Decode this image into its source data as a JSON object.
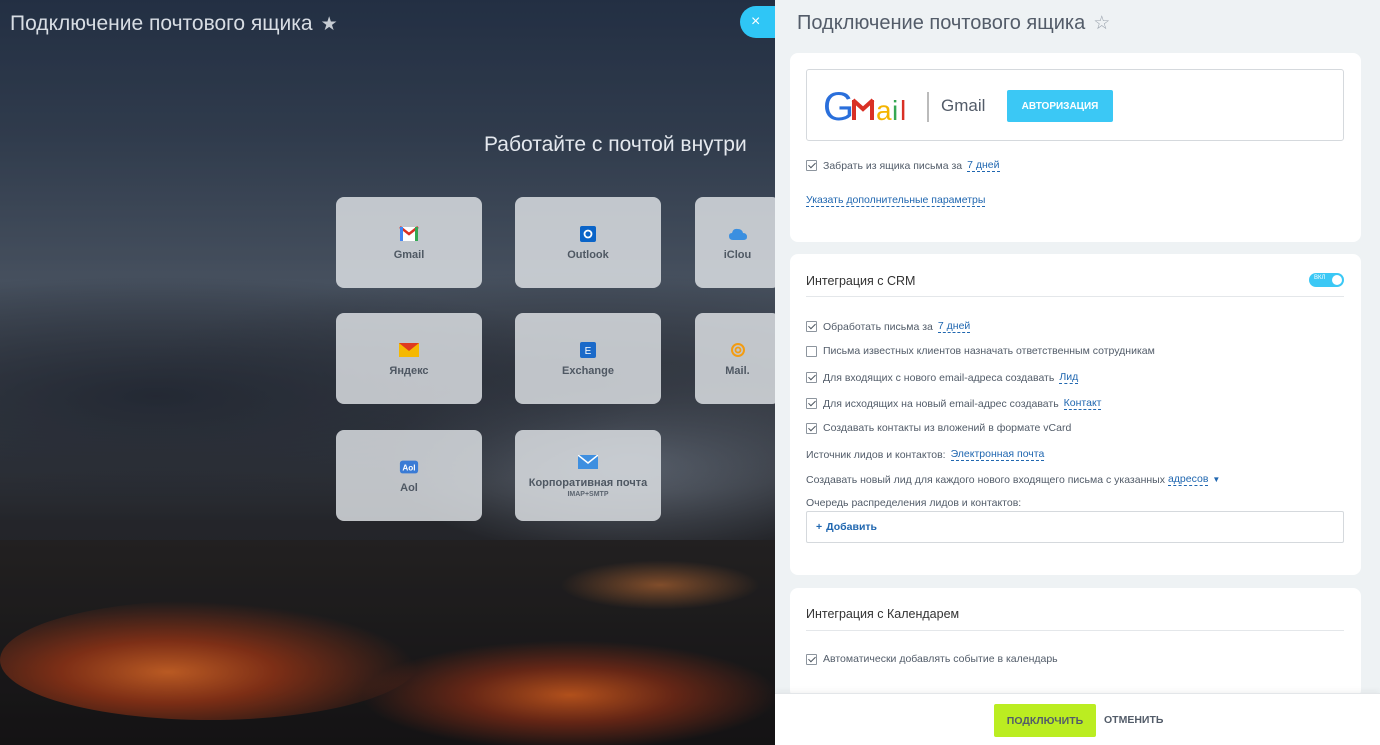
{
  "background": {
    "title": "Подключение почтового ящика",
    "heading": "Работайте с почтой внутри",
    "tiles": [
      {
        "label": "Gmail",
        "sub": ""
      },
      {
        "label": "Outlook",
        "sub": ""
      },
      {
        "label": "iClou",
        "sub": ""
      },
      {
        "label": "Яндекс",
        "sub": ""
      },
      {
        "label": "Exchange",
        "sub": ""
      },
      {
        "label": "Mail.",
        "sub": ""
      },
      {
        "label": "Aol",
        "sub": ""
      },
      {
        "label": "Корпоративная почта",
        "sub": "IMAP+SMTP"
      }
    ],
    "close_glyph": "×"
  },
  "panel": {
    "title": "Подключение почтового ящика",
    "mailbox": {
      "service_name": "Gmail",
      "auth_button": "Авторизация",
      "fetch_label": "Забрать из ящика письма за",
      "fetch_period": "7 дней",
      "advanced_link": "Указать дополнительные параметры"
    },
    "crm": {
      "title": "Интеграция с CRM",
      "toggle_label": "ВКЛ",
      "toggle_on": true,
      "process_label": "Обработать письма за",
      "process_period": "7 дней",
      "known_clients_label": "Письма известных клиентов назначать ответственным сотрудникам",
      "incoming_label": "Для входящих с нового email-адреса создавать",
      "incoming_entity": "Лид",
      "outgoing_label": "Для исходящих на новый email-адрес создавать",
      "outgoing_entity": "Контакт",
      "vcard_label": "Создавать контакты из вложений в формате vCard",
      "source_label": "Источник лидов и контактов:",
      "source_value": "Электронная почта",
      "new_lead_label": "Создавать новый лид для каждого нового входящего письма с указанных",
      "new_lead_link": "адресов",
      "queue_label": "Очередь распределения лидов и контактов:",
      "add_label": "Добавить"
    },
    "calendar": {
      "title": "Интеграция с Календарем",
      "auto_label": "Автоматически добавлять событие в календарь"
    },
    "footer": {
      "connect": "ПОДКЛЮЧИТЬ",
      "cancel": "ОТМЕНИТЬ"
    }
  },
  "checkboxes": {
    "fetch": true,
    "process": true,
    "known_clients": false,
    "incoming": true,
    "outgoing": true,
    "vcard": true,
    "calendar_auto": true
  },
  "colors": {
    "accent": "#3bc8f5",
    "link": "#2067b0",
    "connect_button": "#bbed21"
  }
}
